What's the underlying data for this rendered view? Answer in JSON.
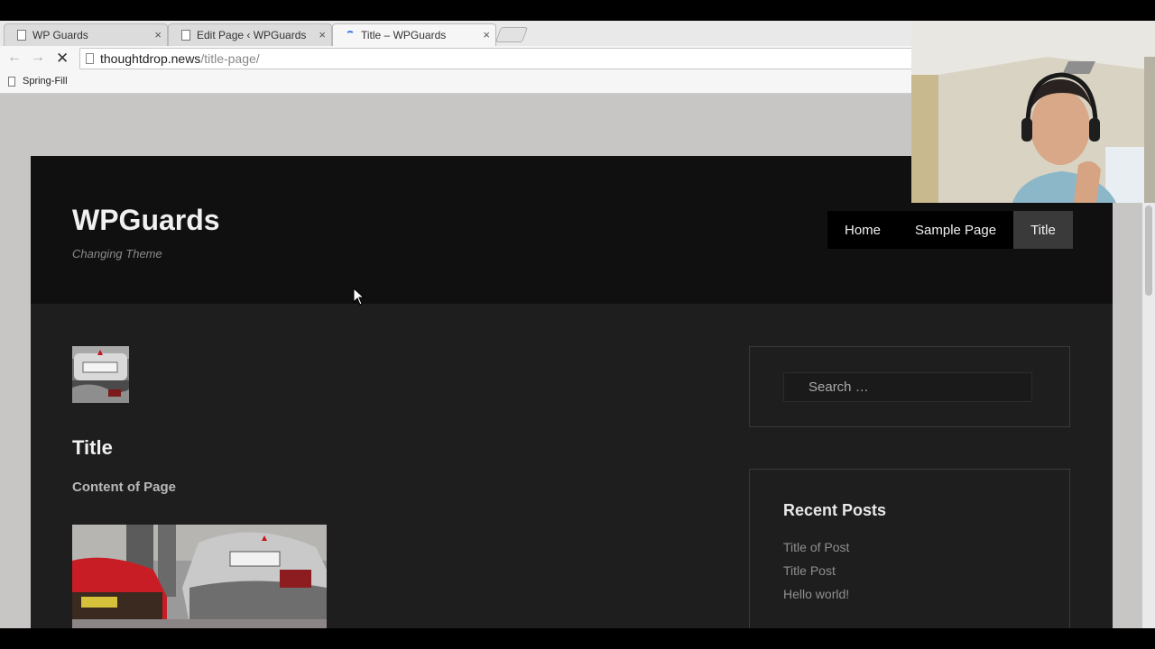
{
  "browser": {
    "tabs": [
      {
        "title": "WP Guards",
        "state": "normal"
      },
      {
        "title": "Edit Page ‹ WPGuards — W",
        "state": "normal"
      },
      {
        "title": "Title – WPGuards",
        "state": "loading"
      }
    ],
    "url_host": "thoughtdrop.news",
    "url_path": "/title-page/",
    "bookmark": "Spring-Fill",
    "close_glyph": "×",
    "back_glyph": "←",
    "forward_glyph": "→",
    "stop_glyph": "✕"
  },
  "site": {
    "title": "WPGuards",
    "description": "Changing Theme",
    "nav": [
      {
        "label": "Home",
        "current": false
      },
      {
        "label": "Sample Page",
        "current": false
      },
      {
        "label": "Title",
        "current": true
      }
    ]
  },
  "page": {
    "title": "Title",
    "content": "Content of Page"
  },
  "sidebar": {
    "search_placeholder": "Search …",
    "recent_title": "Recent Posts",
    "recent_posts": [
      "Title of Post",
      "Title Post",
      "Hello world!"
    ]
  },
  "colors": {
    "header_bg": "#101010",
    "body_bg": "#1e1e1e",
    "page_bg": "#c8c5c5",
    "current_nav_bg": "#3a3a3a"
  }
}
